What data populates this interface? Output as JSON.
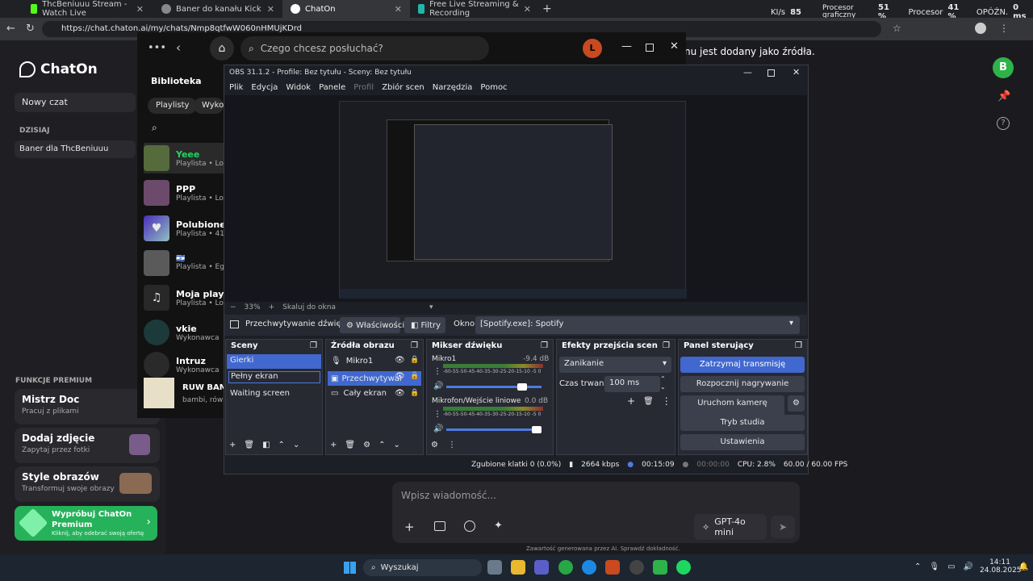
{
  "browser": {
    "tabs": [
      {
        "label": "ThcBeniuuu Stream - Watch Live",
        "color": "#53fc18"
      },
      {
        "label": "Baner do kanału Kick",
        "color": "#888888"
      },
      {
        "label": "ChatOn",
        "color": "#ffffff"
      },
      {
        "label": "Free Live Streaming & Recording",
        "color": "#21b6a8"
      }
    ],
    "url": "https://chat.chaton.ai/my/chats/Nmp8qtfwW060nHMUjKDrd",
    "stats": {
      "net_label": "KI/s",
      "net_value": "85",
      "gpu_label": "Procesor graficzny",
      "gpu_value": "51 %",
      "cpu_label": "Procesor",
      "cpu_value": "41 %",
      "lat_label": "OPÓŹN.",
      "lat_value": "0 ms"
    }
  },
  "chaton": {
    "logo": "ChatOn",
    "new_chat": "Nowy czat",
    "today": "DZISIAJ",
    "chat_item": "Baner dla ThcBeniuuu",
    "premium_header": "FUNKCJE PREMIUM",
    "features": [
      {
        "title": "Mistrz Doc",
        "sub": "Pracuj z plikami"
      },
      {
        "title": "Dodaj zdjęcie",
        "sub": "Zapytaj przez fotki"
      },
      {
        "title": "Style obrazów",
        "sub": "Transformuj swoje obrazy"
      }
    ],
    "premium": {
      "title": "Wypróbuj ChatOn Premium",
      "sub": "Kliknij, aby odebrać swoją ofertę"
    },
    "message_fragment": "nu jest dodany jako źródła.",
    "avatar_letter": "B",
    "input_placeholder": "Wpisz wiadomość...",
    "model": "GPT-4o mini",
    "disclaimer": "Zawartość generowana przez AI. Sprawdź dokładność."
  },
  "spotify": {
    "search_placeholder": "Czego chcesz posłuchać?",
    "avatar_letter": "L",
    "library": "Biblioteka",
    "filters": [
      "Playlisty",
      "Wykon"
    ],
    "items": [
      {
        "title": "Yeee",
        "sub": "Playlista • Lo"
      },
      {
        "title": "PPP",
        "sub": "Playlista • Lo"
      },
      {
        "title": "Polubione u",
        "sub": "Playlista • 41"
      },
      {
        "title": "🇮🇱",
        "sub": "Playlista • Eg"
      },
      {
        "title": "Moja playlis",
        "sub": "Playlista • Lo"
      },
      {
        "title": "vkie",
        "sub": "Wykonawca"
      },
      {
        "title": "Intruz",
        "sub": "Wykonawca"
      }
    ],
    "now_playing": {
      "title": "RUW BAMBI",
      "sub": "bambi, rów ba"
    }
  },
  "obs": {
    "title": "OBS 31.1.2 - Profile: Bez tytułu - Sceny: Bez tytułu",
    "menu": [
      "Plik",
      "Edycja",
      "Widok",
      "Panele",
      "Profil",
      "Zbiór scen",
      "Narzędzia",
      "Pomoc"
    ],
    "zoom": "33%",
    "scale": "Skaluj do okna",
    "source_bar": {
      "name": "Przechwytywanie dźwięku",
      "props": "Właściwości",
      "filters": "Filtry",
      "window_label": "Okno",
      "window_value": "[Spotify.exe]: Spotify"
    },
    "scenes": {
      "title": "Sceny",
      "items": [
        "Gierki",
        "Pełny ekran",
        "Waiting screen"
      ]
    },
    "sources": {
      "title": "Źródła obrazu",
      "items": [
        "Mikro1",
        "Przechwytywar",
        "Cały ekran"
      ]
    },
    "mixer": {
      "title": "Mikser dźwięku",
      "ticks": "-60-55-50-45-40-35-30-25-20-15-10 -5 0",
      "channels": [
        {
          "name": "Mikro1",
          "db": "-9.4 dB",
          "level": 0.83
        },
        {
          "name": "Mikrofon/Wejście liniowe",
          "db": "0.0 dB",
          "level": 1.0
        }
      ]
    },
    "transitions": {
      "title": "Efekty przejścia scen",
      "type": "Zanikanie",
      "duration_label": "Czas trwania",
      "duration": "100 ms"
    },
    "controls": {
      "title": "Panel sterujący",
      "buttons": [
        "Zatrzymaj transmisję",
        "Rozpocznij nagrywanie",
        "Uruchom kamerę wirtualną",
        "Tryb studia",
        "Ustawienia"
      ]
    },
    "status": {
      "dropped": "Zgubione klatki 0 (0.0%)",
      "bitrate": "2664 kbps",
      "stream_time": "00:15:09",
      "rec_time": "00:00:00",
      "cpu": "CPU: 2.8%",
      "fps": "60.00 / 60.00 FPS"
    }
  },
  "taskbar": {
    "search": "Wyszukaj",
    "time": "14:11",
    "date": "24.08.2025"
  }
}
